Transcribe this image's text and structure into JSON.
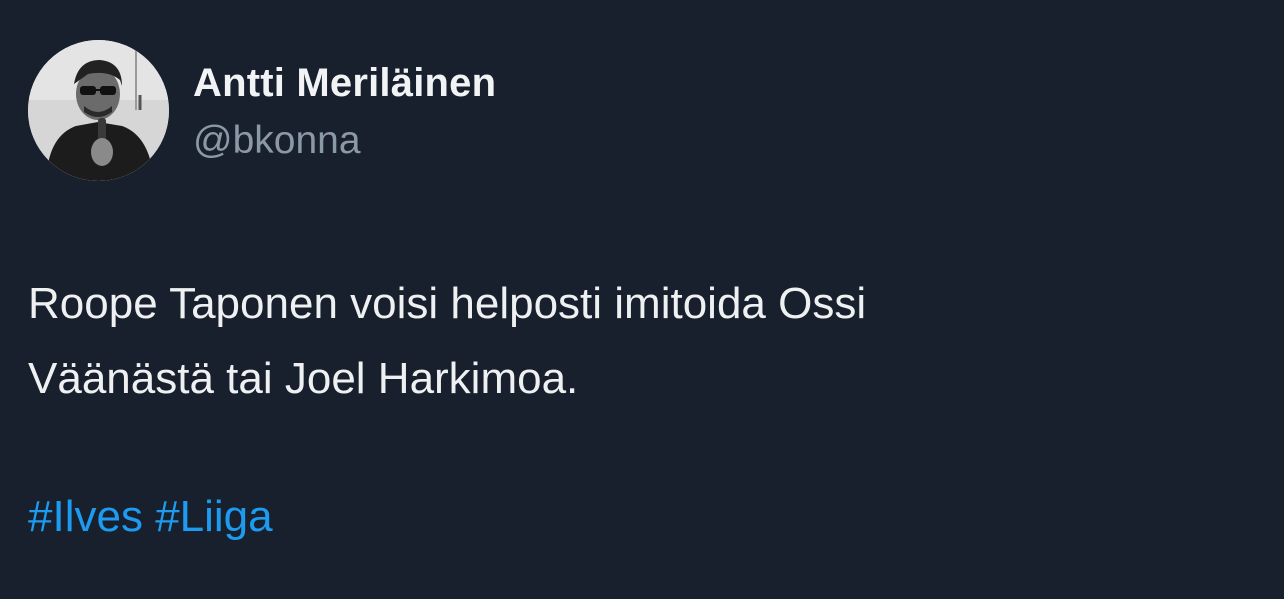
{
  "tweet": {
    "author": {
      "display_name": "Antti Meriläinen",
      "handle": "@bkonna"
    },
    "text_lines": [
      "Roope Taponen voisi helposti imitoida Ossi",
      "Väänästä tai Joel Harkimoa."
    ],
    "hashtags": [
      "#Ilves",
      "#Liiga"
    ]
  },
  "colors": {
    "background": "#17202c",
    "text_primary": "#eef0f1",
    "text_secondary": "#8b98a5",
    "link": "#1d9bf0"
  }
}
